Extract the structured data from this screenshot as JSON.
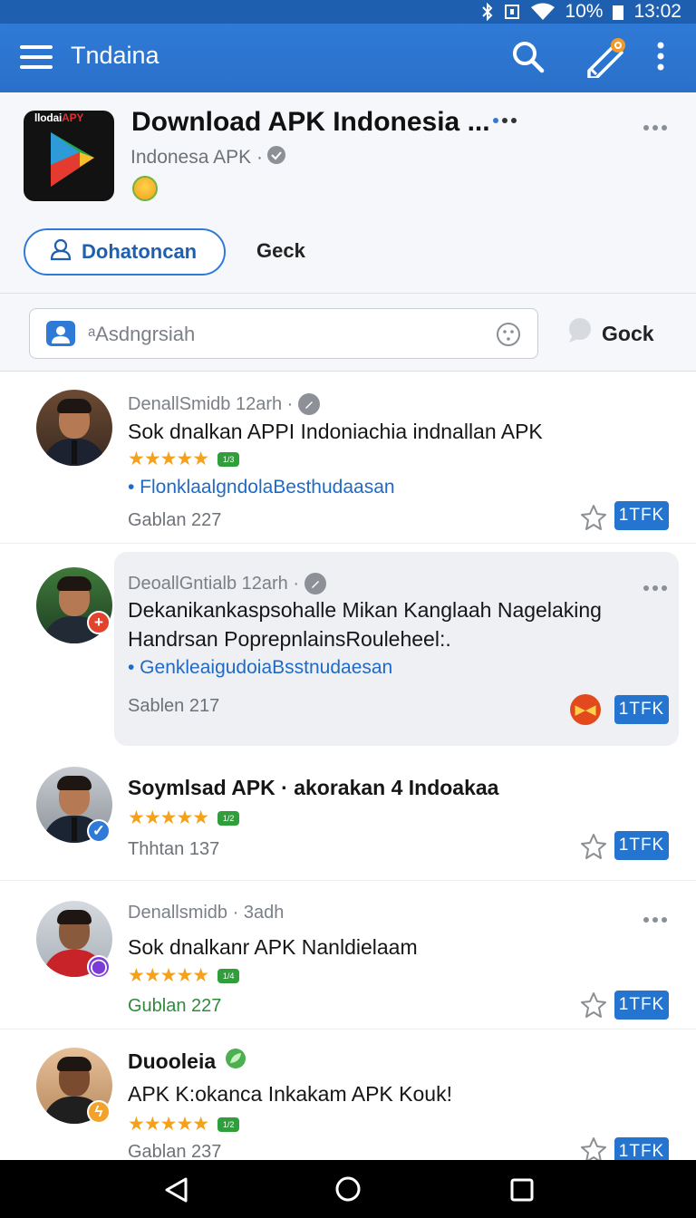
{
  "status_bar": {
    "battery": "10%",
    "time": "13:02"
  },
  "app_bar": {
    "title": "Tndaina"
  },
  "app_header": {
    "name": "Download APK Indonesia ...",
    "publisher": "Indonesa APK ·",
    "logo_text_white": "llodai",
    "logo_text_red": "APY",
    "primary_button": "Dohatoncan",
    "secondary_button": "Geck"
  },
  "search": {
    "placeholder": "ᵃAsdngrsiah",
    "action_label": "Gock"
  },
  "feed": {
    "items": [
      {
        "author_meta": "DenallSmidb 12arh ·",
        "text": "Sok dnalkan APPI Indoniachia indnallan APK",
        "link": "• FlonklaalgndolaBesthudaasan",
        "count": "Gablan 227",
        "pill": "1TFK"
      },
      {
        "author_meta": "DeoallGntialb 12arh ·",
        "text": "Dekanikankaspsohalle Mikan Kanglaah Nagelaking",
        "text2": "Handrsan PoprepnlainsRouleheel:.",
        "link": "• GenkleaigudoiaBsstnudaesan",
        "count": "Sablen 217",
        "pill": "1TFK"
      },
      {
        "text": "Soymlsad APK · akorakan 4 Indoakaa",
        "count": "Thhtan 137",
        "pill": "1TFK"
      },
      {
        "author_meta": "Denallsmidb · 3adh",
        "text": "Sok dnalkanr APK Nanldielaam",
        "count": "Gublan 227",
        "pill": "1TFK"
      },
      {
        "author_meta": "Duooleia",
        "text": "APK K:okanca Inkakam APK Kouk!",
        "count": "Gablan 237",
        "pill": "1TFK"
      }
    ]
  },
  "rating_badges": [
    "1/3",
    "1/2",
    "1/4",
    "1/2"
  ],
  "colors": {
    "app_bar": "#2a70c9",
    "accent_blue": "#2575d0",
    "star": "#f4a11c",
    "link": "#1f6ac7"
  }
}
